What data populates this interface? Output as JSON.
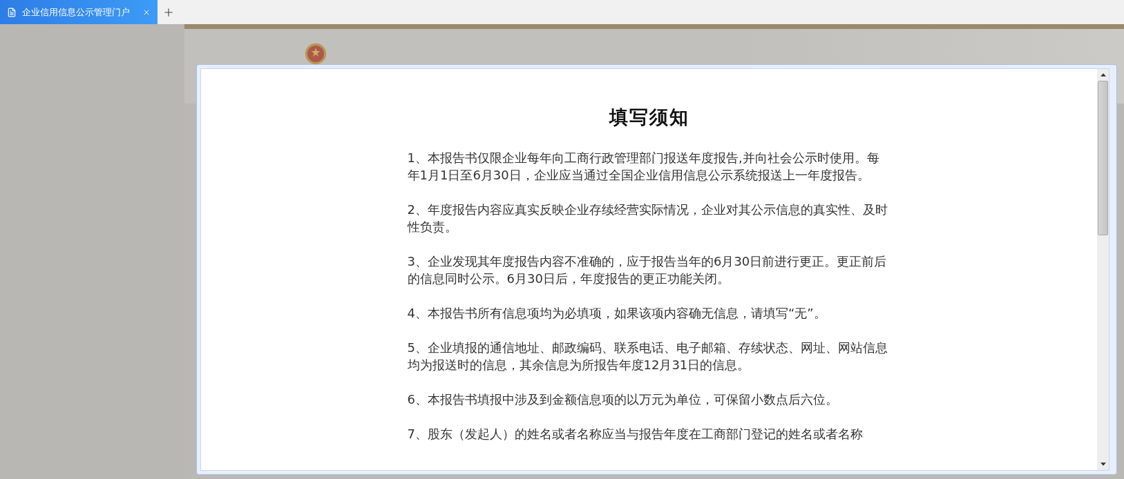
{
  "browser_tab": {
    "title": "企业信用信息公示管理门户",
    "selected": true
  },
  "dialog": {
    "title": "填写须知",
    "items": [
      "1、本报告书仅限企业每年向工商行政管理部门报送年度报告,并向社会公示时使用。每年1月1日至6月30日，企业应当通过全国企业信用信息公示系统报送上一年度报告。",
      "2、年度报告内容应真实反映企业存续经营实际情况，企业对其公示信息的真实性、及时性负责。",
      "3、企业发现其年度报告内容不准确的，应于报告当年的6月30日前进行更正。更正前后的信息同时公示。6月30日后，年度报告的更正功能关闭。",
      "4、本报告书所有信息项均为必填项，如果该项内容确无信息，请填写“无”。",
      "5、企业填报的通信地址、邮政编码、联系电话、电子邮箱、存续状态、网址、网站信息均为报送时的信息，其余信息为所报告年度12月31日的信息。",
      "6、本报告书填报中涉及到金额信息项的以万元为单位，可保留小数点后六位。",
      "7、股东（发起人）的姓名或者名称应当与报告年度在工商部门登记的姓名或者名称"
    ]
  }
}
